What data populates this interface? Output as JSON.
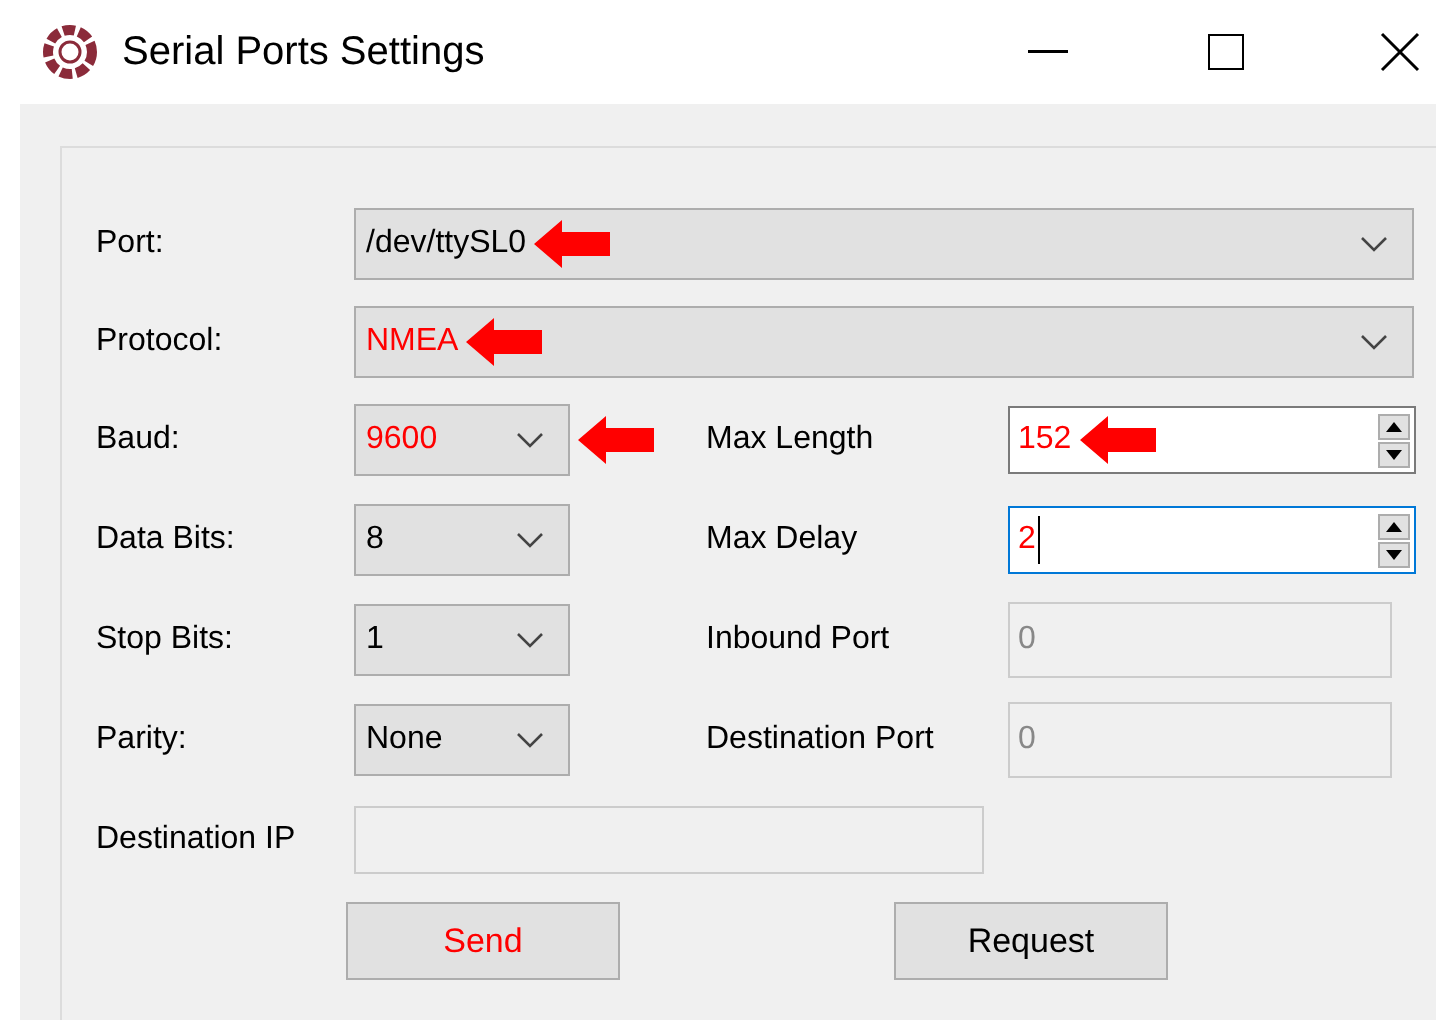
{
  "window": {
    "title": "Serial Ports Settings"
  },
  "wide_fields": [
    {
      "label": "Port:",
      "value": "/dev/ttySL0",
      "modified": false,
      "annotated": true
    },
    {
      "label": "Protocol:",
      "value": "NMEA",
      "modified": true,
      "annotated": true
    }
  ],
  "left_fields": [
    {
      "label": "Baud:",
      "value": "9600",
      "modified": true,
      "annotated": true
    },
    {
      "label": "Data Bits:",
      "value": "8",
      "modified": false,
      "annotated": false
    },
    {
      "label": "Stop Bits:",
      "value": "1",
      "modified": false,
      "annotated": false
    },
    {
      "label": "Parity:",
      "value": "None",
      "modified": false,
      "annotated": false
    }
  ],
  "right_fields": [
    {
      "label": "Max Length",
      "value": "152",
      "kind": "spin",
      "modified": true,
      "annotated": true,
      "disabled": false,
      "focused": false
    },
    {
      "label": "Max Delay",
      "value": "2",
      "kind": "spin",
      "modified": true,
      "annotated": false,
      "disabled": false,
      "focused": true
    },
    {
      "label": "Inbound Port",
      "value": "0",
      "kind": "text",
      "modified": false,
      "annotated": false,
      "disabled": true,
      "focused": false
    },
    {
      "label": "Destination Port",
      "value": "0",
      "kind": "text",
      "modified": false,
      "annotated": false,
      "disabled": true,
      "focused": false
    }
  ],
  "destination_ip": {
    "label": "Destination IP",
    "disabled": true
  },
  "buttons": [
    {
      "label": "Send",
      "modified": true
    },
    {
      "label": "Request",
      "modified": false
    }
  ]
}
